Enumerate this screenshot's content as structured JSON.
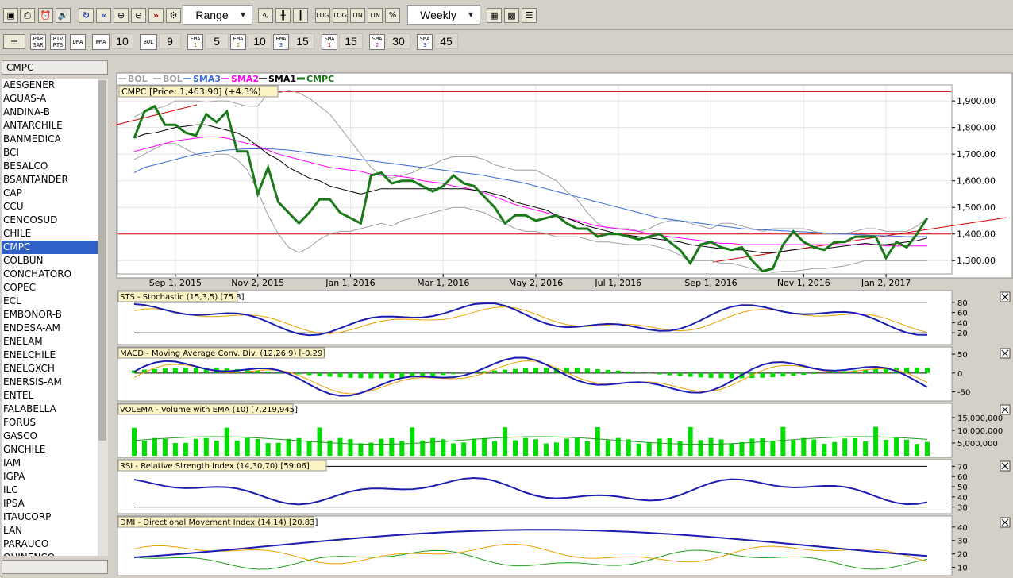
{
  "toolbar": {
    "range_select": "Range",
    "period_select": "Weekly",
    "log_label": "LOG",
    "lin_label": "LIN",
    "percent_label": "%",
    "icons": [
      "new-chart",
      "print",
      "alarm",
      "sound",
      "refresh",
      "rewind",
      "zoom-in",
      "zoom-out",
      "fast-forward",
      "line-chart",
      "bar-chart",
      "candle-chart",
      "settings",
      "colors",
      "data-table"
    ]
  },
  "indicator_bar": {
    "par_sar": [
      "PAR",
      "SAR"
    ],
    "piv_pts": [
      "PIV",
      "PTS"
    ],
    "dma": "DMA",
    "wma": "WMA",
    "wma_period": "10",
    "bol": "BOL",
    "bol_period": "9",
    "ema1": [
      "EMA",
      "1"
    ],
    "ema1_period": "5",
    "ema2": [
      "EMA",
      "2"
    ],
    "ema2_period": "10",
    "ema3": [
      "EMA",
      "3"
    ],
    "ema3_period": "15",
    "sma1": [
      "SMA",
      "1"
    ],
    "sma1_period": "15",
    "sma2": [
      "SMA",
      "2"
    ],
    "sma2_period": "30",
    "sma3": [
      "SMA",
      "3"
    ],
    "sma3_period": "45"
  },
  "sidebar": {
    "symbol_value": "CMPC",
    "selected": "CMPC",
    "symbols": [
      "AESGENER",
      "AGUAS-A",
      "ANDINA-B",
      "ANTARCHILE",
      "BANMEDICA",
      "BCI",
      "BESALCO",
      "BSANTANDER",
      "CAP",
      "CCU",
      "CENCOSUD",
      "CHILE",
      "CMPC",
      "COLBUN",
      "CONCHATORO",
      "COPEC",
      "ECL",
      "EMBONOR-B",
      "ENDESA-AM",
      "ENELAM",
      "ENELCHILE",
      "ENELGXCH",
      "ENERSIS-AM",
      "ENTEL",
      "FALABELLA",
      "FORUS",
      "GASCO",
      "GNCHILE",
      "IAM",
      "IGPA",
      "ILC",
      "IPSA",
      "ITAUCORP",
      "LAN",
      "PARAUCO",
      "QUINENCO"
    ]
  },
  "colors": {
    "price": "#1a7a1a",
    "sma1": "#000000",
    "sma2": "#ff00ff",
    "sma3": "#3a6ad8",
    "bol": "#a0a0a0",
    "blue": "#1c1cb0",
    "orange": "#f0a000",
    "green_bar": "#00dd00",
    "red_line": "#d00000"
  },
  "price_panel": {
    "legend": [
      "BOL",
      "BOL",
      "SMA3",
      "SMA2",
      "SMA1",
      "CMPC"
    ],
    "title": "CMPC [Price: 1,463.90] (+4.3%)",
    "yticks": [
      "1,900.00",
      "1,800.00",
      "1,700.00",
      "1,600.00",
      "1,500.00",
      "1,400.00",
      "1,300.00"
    ],
    "xticks": [
      "Sep 1, 2015",
      "Nov 2, 2015",
      "Jan 1, 2016",
      "Mar 1, 2016",
      "May 2, 2016",
      "Jul 1, 2016",
      "Sep 1, 2016",
      "Nov 1, 2016",
      "Jan 2, 2017"
    ]
  },
  "panels": {
    "sts": {
      "title": "STS - Stochastic (15,3,5) [75.3]",
      "yticks": [
        "80",
        "60",
        "40",
        "20"
      ]
    },
    "macd": {
      "title": "MACD - Moving Average Conv. Div. (12,26,9) [-0.29]",
      "yticks": [
        "50",
        "0",
        "-50"
      ]
    },
    "volema": {
      "title": "VOLEMA - Volume with EMA (10) [7,219,945]",
      "yticks": [
        "15,000,000",
        "10,000,000",
        "5,000,000"
      ]
    },
    "rsi": {
      "title": "RSI - Relative Strength Index (14,30,70) [59.06]",
      "yticks": [
        "70",
        "60",
        "50",
        "40",
        "30"
      ]
    },
    "dmi": {
      "title": "DMI - Directional Movement Index (14,14) [20.83]",
      "yticks": [
        "40",
        "30",
        "20",
        "10"
      ]
    }
  },
  "chart_data": {
    "type": "line",
    "title": "CMPC [Price: 1,463.90] (+4.3%)",
    "x": [
      "2015-08-07",
      "2015-08-14",
      "2015-08-21",
      "2015-08-28",
      "2015-09-04",
      "2015-09-11",
      "2015-09-18",
      "2015-09-25",
      "2015-10-02",
      "2015-10-09",
      "2015-10-16",
      "2015-10-23",
      "2015-10-30",
      "2015-11-06",
      "2015-11-13",
      "2015-11-20",
      "2015-11-27",
      "2015-12-04",
      "2015-12-11",
      "2015-12-18",
      "2015-12-25",
      "2016-01-01",
      "2016-01-08",
      "2016-01-15",
      "2016-01-22",
      "2016-01-29",
      "2016-02-05",
      "2016-02-12",
      "2016-02-19",
      "2016-02-26",
      "2016-03-04",
      "2016-03-11",
      "2016-03-18",
      "2016-03-25",
      "2016-04-01",
      "2016-04-08",
      "2016-04-15",
      "2016-04-22",
      "2016-04-29",
      "2016-05-06",
      "2016-05-13",
      "2016-05-20",
      "2016-05-27",
      "2016-06-03",
      "2016-06-10",
      "2016-06-17",
      "2016-06-24",
      "2016-07-01",
      "2016-07-08",
      "2016-07-15",
      "2016-07-22",
      "2016-07-29",
      "2016-08-05",
      "2016-08-12",
      "2016-08-19",
      "2016-08-26",
      "2016-09-02",
      "2016-09-09",
      "2016-09-16",
      "2016-09-23",
      "2016-09-30",
      "2016-10-07",
      "2016-10-14",
      "2016-10-21",
      "2016-10-28",
      "2016-11-04",
      "2016-11-11",
      "2016-11-18",
      "2016-11-25",
      "2016-12-02",
      "2016-12-09",
      "2016-12-16",
      "2016-12-23",
      "2016-12-30",
      "2017-01-06",
      "2017-01-13",
      "2017-01-20",
      "2017-01-27"
    ],
    "ylim": [
      1250,
      1960
    ],
    "series": [
      {
        "name": "CMPC",
        "values": [
          1760,
          1860,
          1880,
          1810,
          1810,
          1780,
          1770,
          1850,
          1820,
          1860,
          1710,
          1710,
          1550,
          1650,
          1520,
          1480,
          1440,
          1480,
          1530,
          1530,
          1480,
          1460,
          1440,
          1620,
          1630,
          1590,
          1600,
          1600,
          1580,
          1560,
          1580,
          1620,
          1590,
          1580,
          1540,
          1500,
          1440,
          1470,
          1470,
          1450,
          1460,
          1470,
          1440,
          1420,
          1420,
          1390,
          1400,
          1400,
          1390,
          1380,
          1390,
          1400,
          1370,
          1340,
          1290,
          1360,
          1370,
          1350,
          1340,
          1350,
          1300,
          1260,
          1270,
          1360,
          1410,
          1370,
          1350,
          1340,
          1370,
          1370,
          1390,
          1390,
          1390,
          1310,
          1370,
          1350,
          1400,
          1460
        ]
      },
      {
        "name": "SMA1",
        "values": [
          1760,
          1775,
          1780,
          1790,
          1800,
          1805,
          1810,
          1810,
          1800,
          1790,
          1780,
          1760,
          1730,
          1700,
          1680,
          1650,
          1630,
          1610,
          1600,
          1580,
          1570,
          1560,
          1550,
          1560,
          1570,
          1570,
          1570,
          1570,
          1570,
          1570,
          1570,
          1570,
          1570,
          1565,
          1560,
          1550,
          1540,
          1520,
          1510,
          1500,
          1490,
          1470,
          1460,
          1445,
          1430,
          1420,
          1410,
          1400,
          1395,
          1390,
          1385,
          1380,
          1375,
          1370,
          1360,
          1355,
          1350,
          1345,
          1340,
          1340,
          1335,
          1330,
          1330,
          1335,
          1340,
          1345,
          1345,
          1345,
          1350,
          1355,
          1360,
          1365,
          1360,
          1360,
          1365,
          1370,
          1375,
          1385
        ]
      },
      {
        "name": "SMA2",
        "values": [
          1710,
          1720,
          1730,
          1740,
          1750,
          1755,
          1760,
          1765,
          1765,
          1760,
          1750,
          1740,
          1730,
          1715,
          1700,
          1690,
          1680,
          1670,
          1660,
          1650,
          1645,
          1640,
          1635,
          1625,
          1620,
          1620,
          1615,
          1610,
          1600,
          1595,
          1590,
          1580,
          1575,
          1565,
          1555,
          1540,
          1525,
          1510,
          1500,
          1490,
          1480,
          1470,
          1460,
          1450,
          1440,
          1430,
          1425,
          1420,
          1415,
          1410,
          1400,
          1395,
          1390,
          1385,
          1380,
          1375,
          1370,
          1365,
          1365,
          1360,
          1360,
          1360,
          1360,
          1360,
          1360,
          1360,
          1360,
          1360,
          1360,
          1360,
          1360,
          1360,
          1360,
          1355,
          1355,
          1355,
          1355,
          1355
        ]
      },
      {
        "name": "SMA3",
        "values": [
          1630,
          1650,
          1660,
          1670,
          1680,
          1690,
          1700,
          1705,
          1710,
          1715,
          1718,
          1720,
          1720,
          1720,
          1718,
          1715,
          1710,
          1705,
          1700,
          1695,
          1690,
          1685,
          1680,
          1675,
          1670,
          1665,
          1660,
          1655,
          1650,
          1645,
          1640,
          1635,
          1630,
          1625,
          1620,
          1612,
          1605,
          1598,
          1590,
          1580,
          1570,
          1560,
          1550,
          1540,
          1530,
          1520,
          1510,
          1500,
          1490,
          1480,
          1470,
          1460,
          1455,
          1450,
          1445,
          1440,
          1435,
          1430,
          1425,
          1420,
          1418,
          1416,
          1414,
          1412,
          1410,
          1408,
          1406,
          1404,
          1402,
          1400,
          1398,
          1396,
          1394,
          1393,
          1392,
          1390,
          1390,
          1390
        ]
      },
      {
        "name": "BOL",
        "values": [
          1840,
          1860,
          1870,
          1880,
          1900,
          1900,
          1900,
          1895,
          1900,
          1900,
          1890,
          1880,
          1880,
          1930,
          1930,
          1940,
          1930,
          1910,
          1880,
          1850,
          1800,
          1750,
          1700,
          1650,
          1620,
          1610,
          1620,
          1630,
          1650,
          1660,
          1680,
          1690,
          1690,
          1690,
          1680,
          1660,
          1650,
          1640,
          1640,
          1640,
          1620,
          1600,
          1560,
          1530,
          1480,
          1440,
          1420,
          1420,
          1420,
          1410,
          1420,
          1440,
          1450,
          1450,
          1440,
          1430,
          1420,
          1440,
          1440,
          1430,
          1420,
          1410,
          1420,
          1420,
          1420,
          1420,
          1410,
          1400,
          1400,
          1400,
          1410,
          1420,
          1420,
          1410,
          1410,
          1410,
          1430,
          1460
        ]
      },
      {
        "name": "BOL",
        "values": [
          1680,
          1700,
          1720,
          1740,
          1740,
          1720,
          1700,
          1690,
          1700,
          1700,
          1680,
          1640,
          1560,
          1470,
          1400,
          1350,
          1330,
          1350,
          1380,
          1400,
          1410,
          1410,
          1420,
          1430,
          1440,
          1430,
          1450,
          1460,
          1470,
          1480,
          1490,
          1500,
          1500,
          1490,
          1480,
          1460,
          1440,
          1420,
          1410,
          1410,
          1400,
          1390,
          1390,
          1390,
          1380,
          1370,
          1370,
          1365,
          1360,
          1360,
          1360,
          1350,
          1340,
          1320,
          1300,
          1300,
          1300,
          1290,
          1290,
          1280,
          1270,
          1260,
          1255,
          1260,
          1260,
          1265,
          1270,
          1270,
          1275,
          1280,
          1290,
          1300,
          1300,
          1300,
          1300,
          1300,
          1300,
          1300
        ]
      }
    ]
  }
}
